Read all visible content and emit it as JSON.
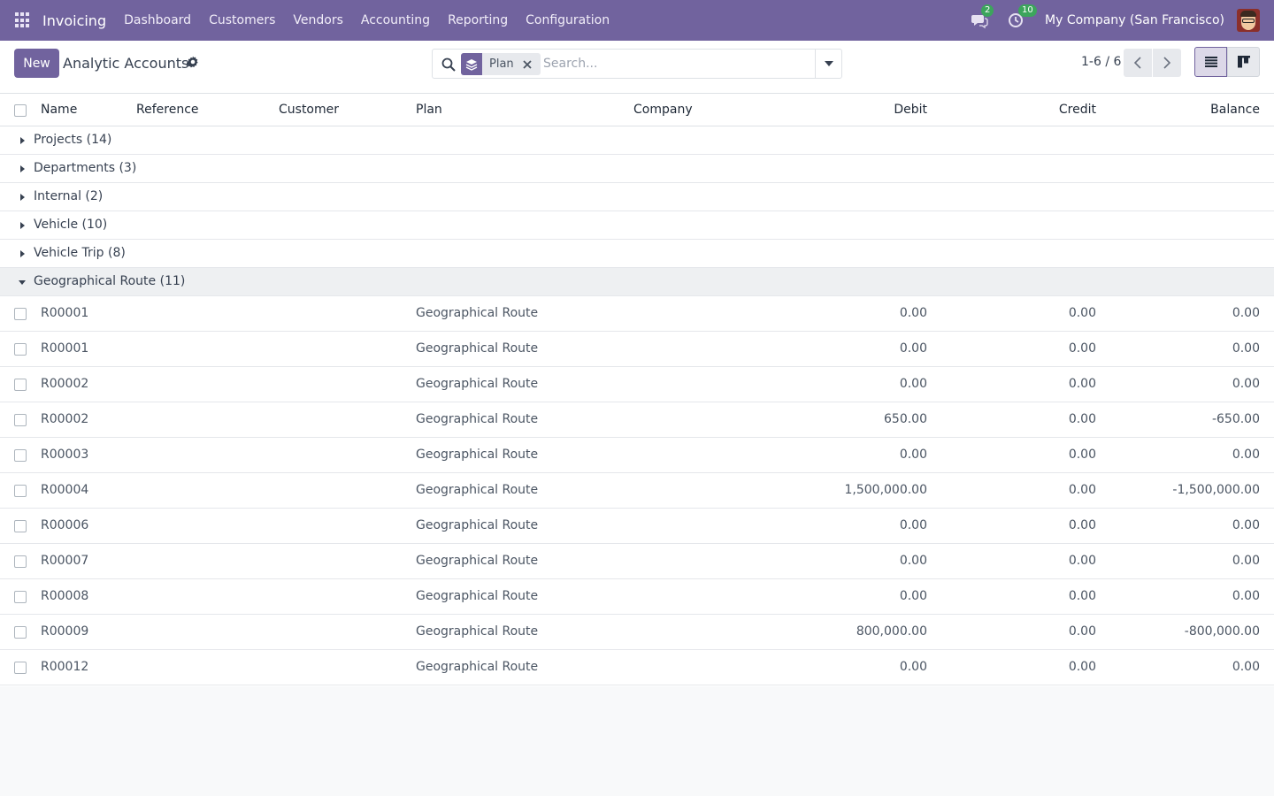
{
  "navbar": {
    "app_name": "Invoicing",
    "menu": [
      "Dashboard",
      "Customers",
      "Vendors",
      "Accounting",
      "Reporting",
      "Configuration"
    ],
    "messages_count": "2",
    "activities_count": "10",
    "company": "My Company (San Francisco)"
  },
  "control": {
    "new_label": "New",
    "title": "Analytic Accounts",
    "facet_label": "Plan",
    "search_placeholder": "Search...",
    "pager": "1-6 / 6"
  },
  "columns": {
    "name": "Name",
    "reference": "Reference",
    "customer": "Customer",
    "plan": "Plan",
    "company": "Company",
    "debit": "Debit",
    "credit": "Credit",
    "balance": "Balance"
  },
  "groups": [
    {
      "label": "Projects (14)",
      "open": false
    },
    {
      "label": "Departments (3)",
      "open": false
    },
    {
      "label": "Internal (2)",
      "open": false
    },
    {
      "label": "Vehicle (10)",
      "open": false
    },
    {
      "label": "Vehicle Trip (8)",
      "open": false
    },
    {
      "label": "Geographical Route (11)",
      "open": true
    }
  ],
  "rows": [
    {
      "name": "R00001",
      "plan": "Geographical Route",
      "debit": "0.00",
      "credit": "0.00",
      "balance": "0.00"
    },
    {
      "name": "R00001",
      "plan": "Geographical Route",
      "debit": "0.00",
      "credit": "0.00",
      "balance": "0.00"
    },
    {
      "name": "R00002",
      "plan": "Geographical Route",
      "debit": "0.00",
      "credit": "0.00",
      "balance": "0.00"
    },
    {
      "name": "R00002",
      "plan": "Geographical Route",
      "debit": "650.00",
      "credit": "0.00",
      "balance": "-650.00"
    },
    {
      "name": "R00003",
      "plan": "Geographical Route",
      "debit": "0.00",
      "credit": "0.00",
      "balance": "0.00"
    },
    {
      "name": "R00004",
      "plan": "Geographical Route",
      "debit": "1,500,000.00",
      "credit": "0.00",
      "balance": "-1,500,000.00"
    },
    {
      "name": "R00006",
      "plan": "Geographical Route",
      "debit": "0.00",
      "credit": "0.00",
      "balance": "0.00"
    },
    {
      "name": "R00007",
      "plan": "Geographical Route",
      "debit": "0.00",
      "credit": "0.00",
      "balance": "0.00"
    },
    {
      "name": "R00008",
      "plan": "Geographical Route",
      "debit": "0.00",
      "credit": "0.00",
      "balance": "0.00"
    },
    {
      "name": "R00009",
      "plan": "Geographical Route",
      "debit": "800,000.00",
      "credit": "0.00",
      "balance": "-800,000.00"
    },
    {
      "name": "R00012",
      "plan": "Geographical Route",
      "debit": "0.00",
      "credit": "0.00",
      "balance": "0.00"
    }
  ],
  "colors": {
    "brand": "#71639e",
    "badge": "#3ca55c"
  }
}
